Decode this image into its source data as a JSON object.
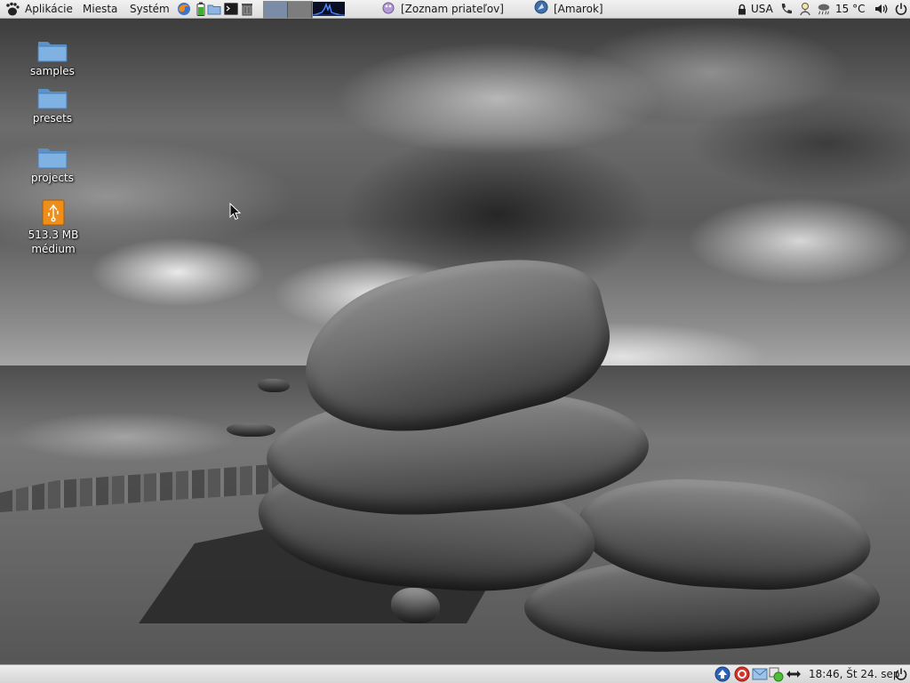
{
  "top_panel": {
    "menus": [
      {
        "label": "Aplikácie"
      },
      {
        "label": "Miesta"
      },
      {
        "label": "Systém"
      }
    ],
    "launchers": [
      "firefox-icon",
      "terminal-icon",
      "folder-icon",
      "monitor-icon",
      "trash-icon",
      "battery-icon"
    ],
    "workspaces": [
      "workspace-1",
      "workspace-2"
    ],
    "tasks": [
      {
        "label": "[Zoznam priateľov]",
        "icon": "pidgin-icon"
      },
      {
        "label": "[Amarok]",
        "icon": "amarok-icon"
      }
    ],
    "keyboard_layout": "USA",
    "weather": "15 °C",
    "lock_icon": "lock-icon",
    "indicators": [
      "phone-icon",
      "network-icon",
      "weather-icon",
      "volume-icon",
      "power-icon"
    ]
  },
  "desktop": {
    "icons": [
      {
        "label": "samples",
        "type": "folder-icon"
      },
      {
        "label": "presets",
        "type": "folder-icon"
      },
      {
        "label": "projects",
        "type": "folder-icon"
      },
      {
        "label": "513.3 MB médium",
        "type": "usb-drive-icon"
      }
    ]
  },
  "bottom_panel": {
    "tray_icons": [
      "update-icon",
      "error-icon",
      "mail-icon",
      "network-status-icon",
      "transfer-icon"
    ],
    "clock": "18:46, Št 24. sep",
    "power_icon": "power-icon"
  },
  "colors": {
    "panel_top": "#f2f2f2",
    "panel_bottom": "#dcdcdc",
    "workspace_active": "#7a8ca6",
    "folder": "#5fa0d8",
    "usb_orange": "#e88a16"
  }
}
